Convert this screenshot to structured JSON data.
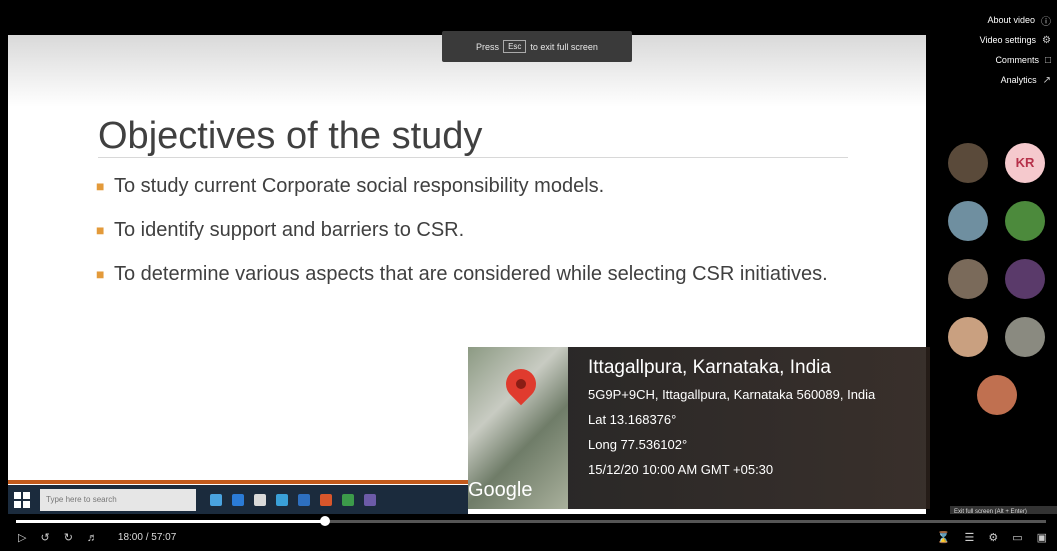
{
  "banner": {
    "pre": "Press",
    "key": "Esc",
    "post": "to exit full screen"
  },
  "slide": {
    "title": "Objectives of the study",
    "bullets": [
      "To study current Corporate social responsibility models.",
      "To identify support and barriers to CSR.",
      "To determine various aspects that are considered while selecting CSR initiatives."
    ]
  },
  "taskbar": {
    "search_placeholder": "Type here to search",
    "icon_colors": [
      "#4aa3df",
      "#2b7bd6",
      "#d9d9d9",
      "#3aa0d8",
      "#2d6fbf",
      "#d8562b",
      "#3c9a4a",
      "#6c5ba8"
    ]
  },
  "geotag": {
    "place": "Ittagallpura, Karnataka, India",
    "address": "5G9P+9CH, Ittagallpura, Karnataka 560089, India",
    "lat": "Lat 13.168376°",
    "long": "Long 77.536102°",
    "datetime": "15/12/20 10:00 AM GMT +05:30",
    "map_provider": "Google"
  },
  "side_menu": [
    {
      "label": "About video",
      "icon": "info-icon"
    },
    {
      "label": "Video settings",
      "icon": "settings-icon"
    },
    {
      "label": "Comments",
      "icon": "comment-icon"
    },
    {
      "label": "Analytics",
      "icon": "chart-icon"
    }
  ],
  "participants": [
    {
      "initials": "",
      "name": "",
      "color": "#5a4a3a"
    },
    {
      "initials": "KR",
      "name": "",
      "color": "#f5c9cd"
    },
    {
      "initials": "",
      "name": "",
      "color": "#6f8fa0"
    },
    {
      "initials": "",
      "name": "",
      "color": "#4c8a3c"
    },
    {
      "initials": "",
      "name": "",
      "color": "#7a6a5a"
    },
    {
      "initials": "",
      "name": "",
      "color": "#5a3a6a"
    },
    {
      "initials": "",
      "name": "",
      "color": "#c9a080"
    },
    {
      "initials": "",
      "name": "",
      "color": "#8a8a80"
    },
    {
      "initials": "",
      "name": "",
      "color": "#c07050"
    }
  ],
  "player": {
    "time": "18:00 / 57:07",
    "progress": 0.3
  },
  "exit_tooltip": "Exit full screen (Alt + Enter)"
}
